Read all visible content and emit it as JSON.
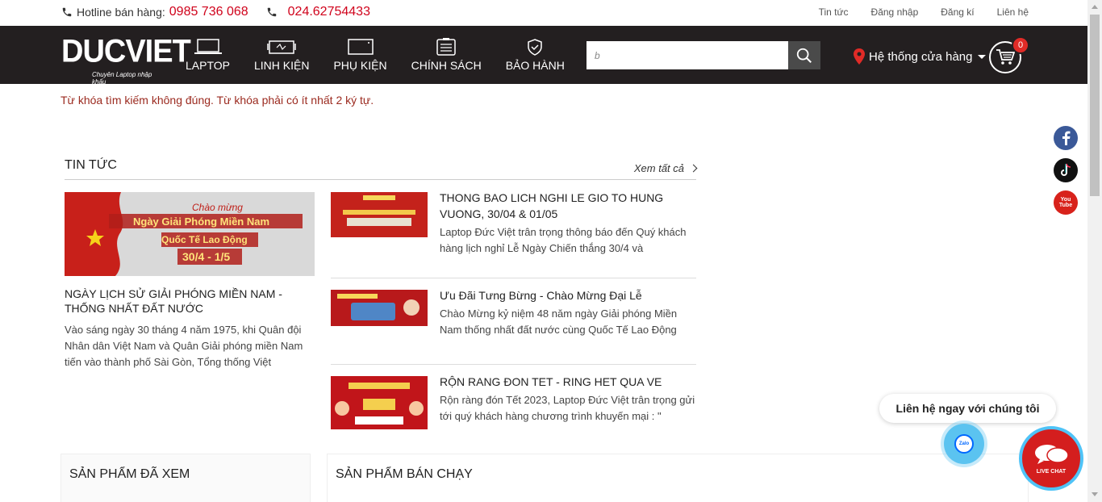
{
  "topbar": {
    "hotline_label": "Hotline bán hàng:",
    "hotline_1": "0985 736 068",
    "hotline_2": "024.62754433",
    "links": [
      "Tin tức",
      "Đăng nhập",
      "Đăng kí",
      "Liên hệ"
    ]
  },
  "header": {
    "logo_text": "DUCVIET",
    "logo_tagline": "Chuyên Laptop nhập khẩu",
    "nav": [
      {
        "label": "LAPTOP",
        "icon": "laptop-icon"
      },
      {
        "label": "LINH KIỆN",
        "icon": "component-icon"
      },
      {
        "label": "PHỤ KIỆN",
        "icon": "accessory-icon"
      },
      {
        "label": "CHÍNH SÁCH",
        "icon": "policy-icon"
      },
      {
        "label": "BẢO HÀNH",
        "icon": "warranty-icon"
      }
    ],
    "search_value": "b",
    "stores_label": "Hệ thống cửa hàng",
    "cart_count": "0"
  },
  "notice": "Từ khóa tìm kiếm không đúng. Từ khóa phải có ít nhất 2 ký tự.",
  "news": {
    "title": "TIN TỨC",
    "more": "Xem tất cả",
    "featured": {
      "image_text_1": "Chào mừng",
      "image_text_2": "Ngày Giải Phóng Miền Nam",
      "image_text_3": "Quốc Tế Lao Động",
      "image_text_4": "30/4 - 1/5",
      "title": "NGÀY LỊCH SỬ GIẢI PHÓNG MIỀN NAM - THỐNG NHẤT ĐẤT NƯỚC",
      "desc": "Vào sáng ngày 30 tháng 4 năm 1975, khi Quân đội Nhân dân Việt Nam và Quân Giải phóng miền Nam tiến vào thành phố Sài Gòn, Tổng thống Việt"
    },
    "items": [
      {
        "title": "THONG BAO LICH NGHI LE GIO TO HUNG VUONG, 30/04 & 01/05",
        "desc": "Laptop Đức Việt trân trọng thông báo đến Quý khách hàng lịch nghỉ Lễ Ngày Chiến thắng 30/4 và"
      },
      {
        "title": "Ưu Đãi Tưng Bừng - Chào Mừng Đại Lễ",
        "desc": "Chào Mừng kỷ niệm 48 năm ngày Giải phóng Miền Nam thống nhất đất nước cùng Quốc Tế Lao Động"
      },
      {
        "title": "RỘN RANG ĐON TET - RING HET QUA VE",
        "desc": "Rộn ràng đón Tết 2023, Laptop Đức Việt trân trọng gửi tới quý khách hàng chương trình khuyến mại : \""
      }
    ]
  },
  "boxes": {
    "viewed": "SẢN PHẨM ĐÃ XEM",
    "bestsellers": "SẢN PHẨM BÁN CHẠY"
  },
  "chat": {
    "bubble": "Liên hệ ngay với chúng tôi",
    "zalo": "Zalo",
    "livechat": "LIVE CHAT"
  },
  "social": {
    "youtube": "You Tube"
  },
  "colors": {
    "accent_red": "#d0021b",
    "header_bg": "#231f20"
  }
}
